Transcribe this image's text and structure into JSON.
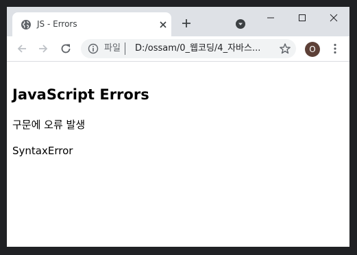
{
  "browser": {
    "tab": {
      "title": "JS - Errors",
      "favicon_icon": "globe-icon",
      "close_icon": "close-icon"
    },
    "new_tab_icon": "plus-icon",
    "tab_search_icon": "chevron-down-circle-icon",
    "window_controls": {
      "minimize_icon": "minimize-icon",
      "maximize_icon": "maximize-icon",
      "close_icon": "close-icon"
    },
    "toolbar": {
      "back_icon": "arrow-left-icon",
      "forward_icon": "arrow-right-icon",
      "reload_icon": "reload-icon",
      "omnibox": {
        "info_icon": "info-icon",
        "scheme_label": "파일",
        "url": "D:/ossam/0_웹코딩/4_자바스..."
      },
      "bookmark_icon": "star-icon",
      "profile_initial": "O",
      "menu_icon": "more-vert-icon"
    },
    "colors": {
      "frame": "#202124",
      "tabstrip": "#dee1e6",
      "omnibox": "#f1f3f4",
      "avatar": "#5d4037"
    }
  },
  "page": {
    "heading": "JavaScript Errors",
    "paragraph1": "구문에 오류 발생",
    "paragraph2": "SyntaxError"
  }
}
